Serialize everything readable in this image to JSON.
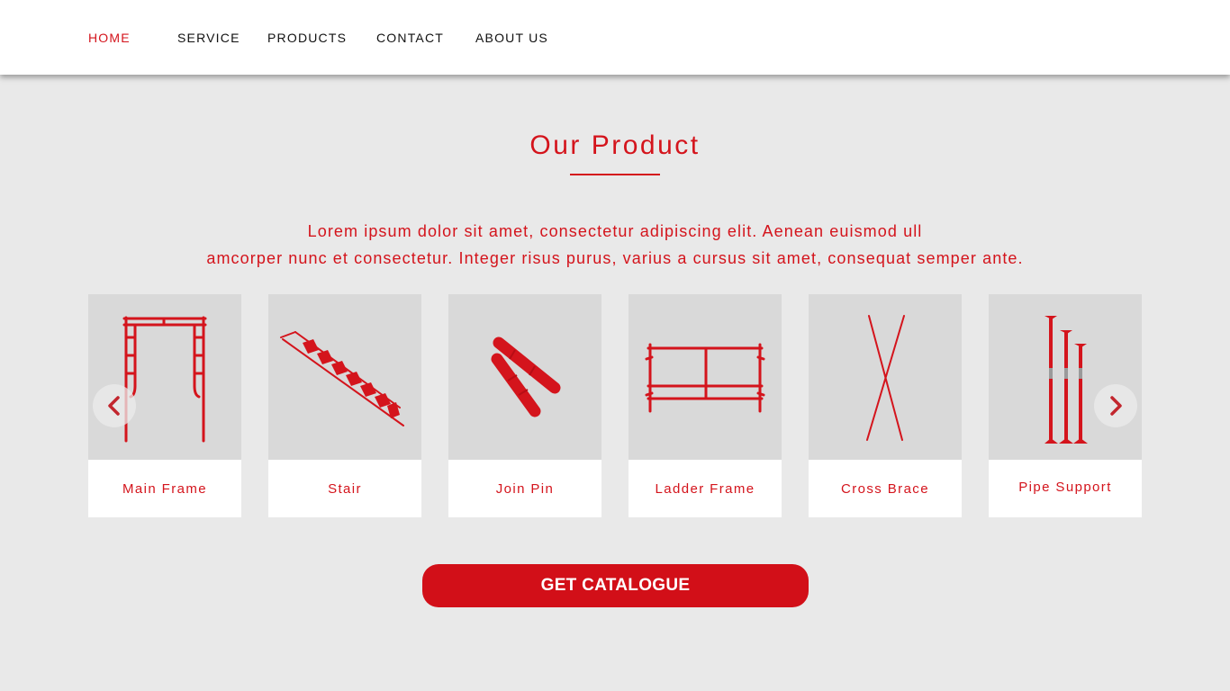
{
  "nav": {
    "items": [
      {
        "label": "HOME",
        "active": true
      },
      {
        "label": "SERVICE",
        "active": false
      },
      {
        "label": "PRODUCTS",
        "active": false
      },
      {
        "label": "CONTACT",
        "active": false
      },
      {
        "label": "ABOUT US",
        "active": false
      }
    ]
  },
  "section": {
    "title": "Our Product",
    "description_line1": "Lorem ipsum dolor sit amet, consectetur adipiscing elit. Aenean euismod ull",
    "description_line2": "amcorper nunc et consectetur. Integer risus purus, varius a cursus sit amet, consequat semper ante."
  },
  "products": [
    {
      "label": "Main Frame",
      "icon": "main-frame-icon"
    },
    {
      "label": "Stair",
      "icon": "stair-icon"
    },
    {
      "label": "Join Pin",
      "icon": "join-pin-icon"
    },
    {
      "label": "Ladder Frame",
      "icon": "ladder-frame-icon"
    },
    {
      "label": "Cross Brace",
      "icon": "cross-brace-icon"
    },
    {
      "label": "Pipe Support",
      "icon": "pipe-support-icon"
    }
  ],
  "carousel": {
    "prev_icon": "chevron-left-icon",
    "next_icon": "chevron-right-icon"
  },
  "cta": {
    "label": "GET CATALOGUE"
  },
  "colors": {
    "accent": "#d4141c",
    "button": "#d20f18",
    "background": "#e9e9e9",
    "card_image_bg": "#d9d9d9",
    "nav_text": "#111111"
  }
}
